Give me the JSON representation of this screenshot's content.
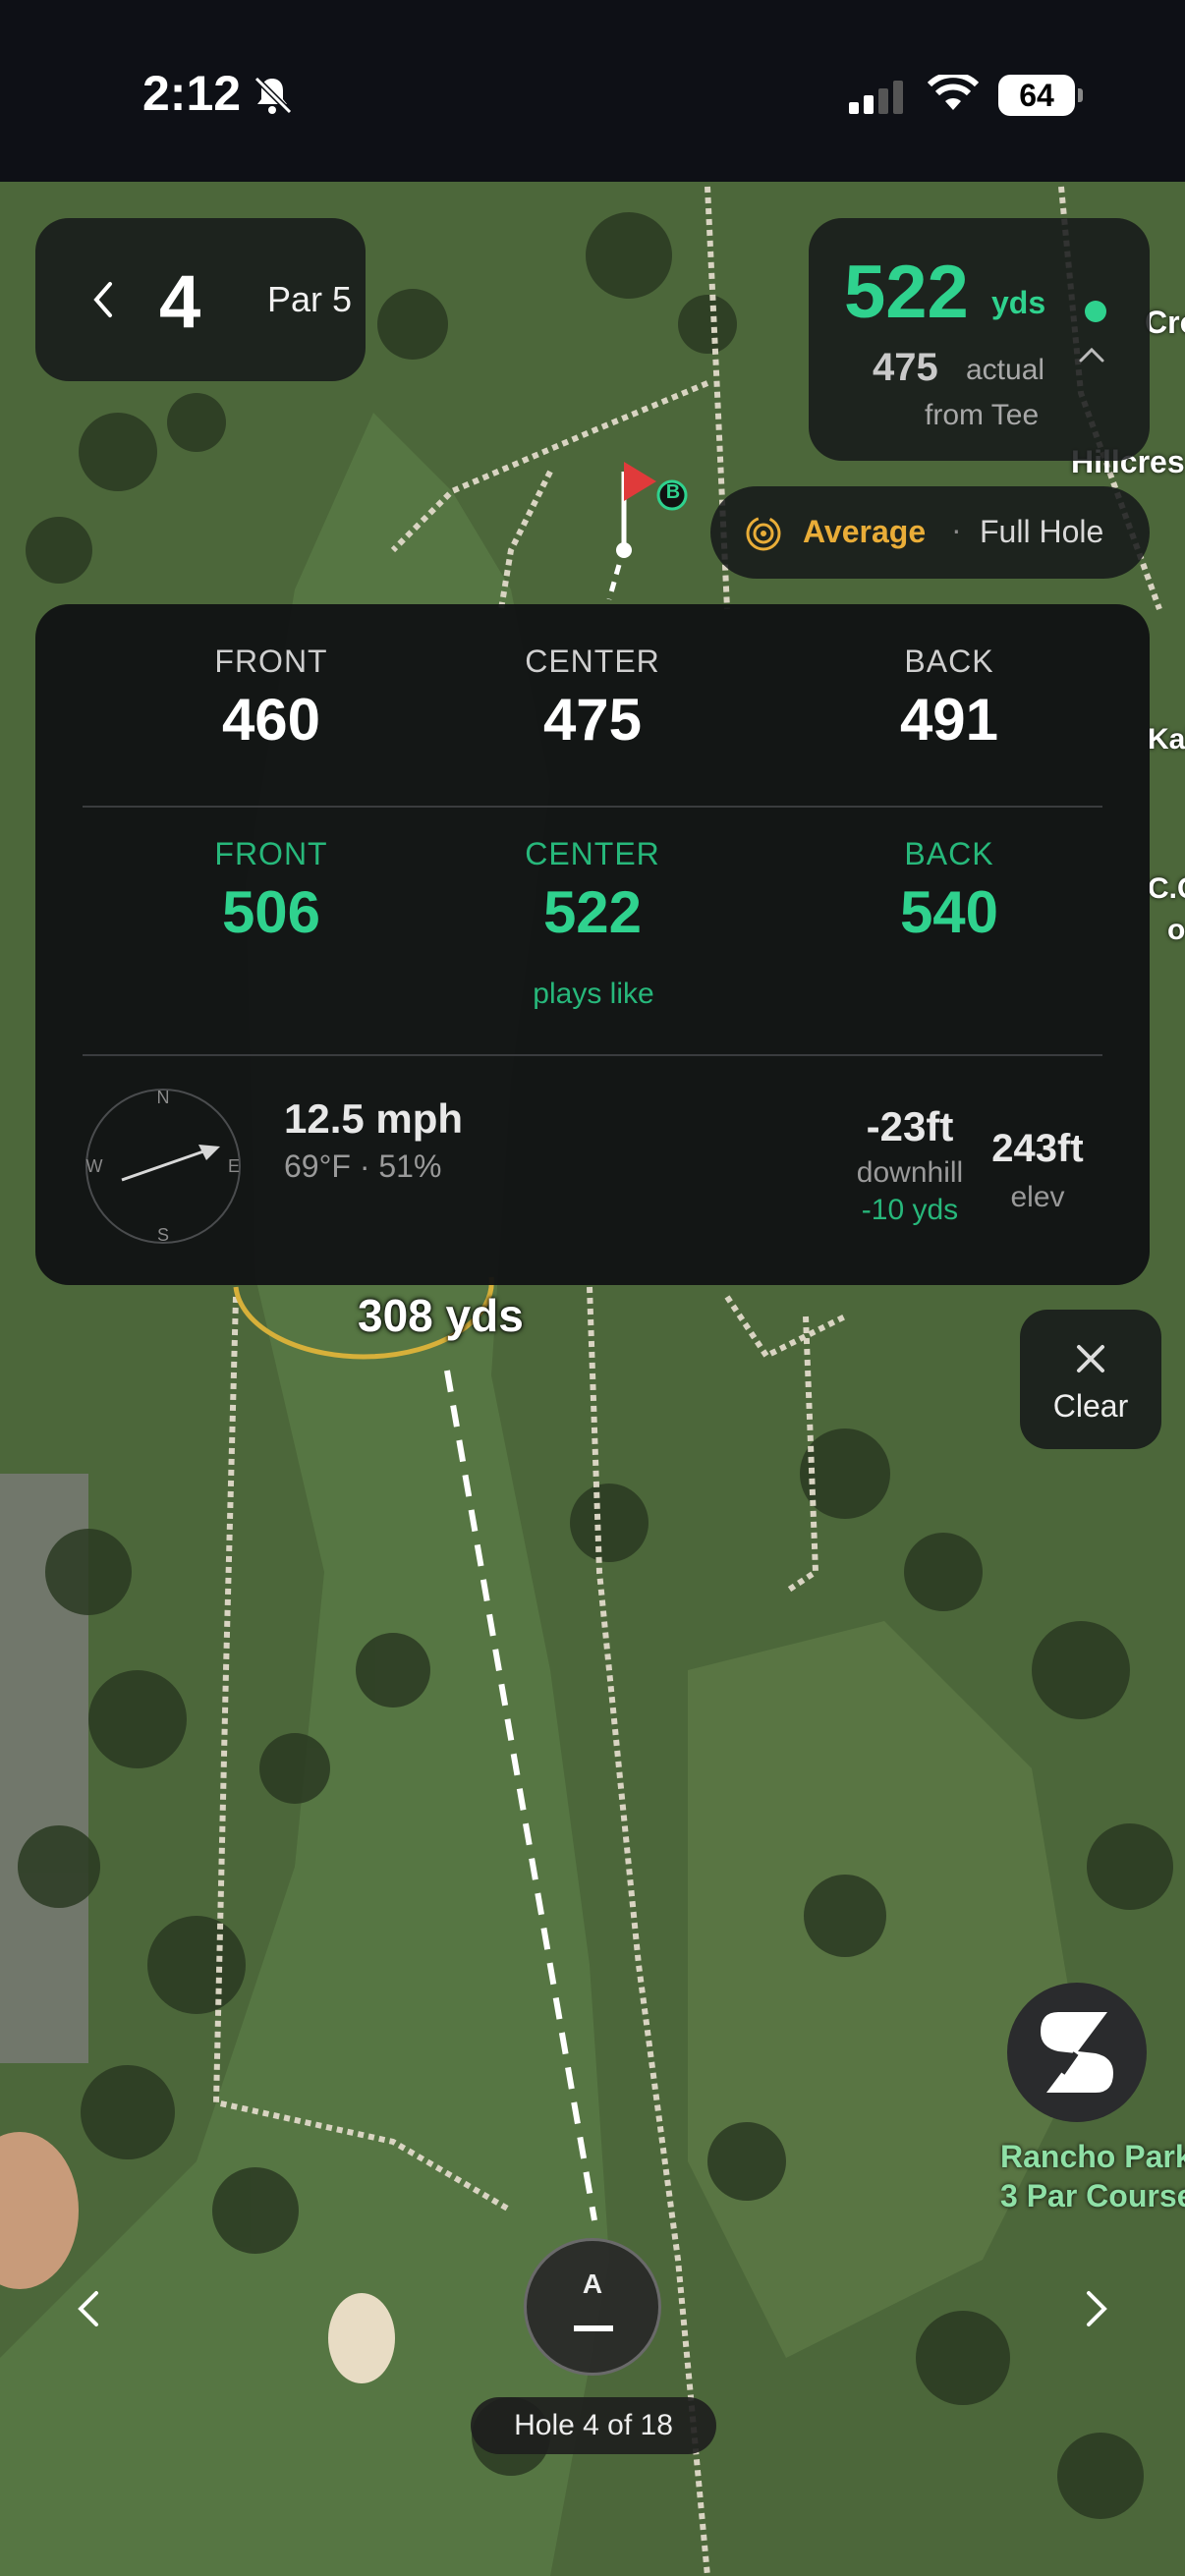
{
  "status_bar": {
    "time": "2:12",
    "battery": "64"
  },
  "hole": {
    "number": "4",
    "par": "Par 5"
  },
  "yardage": {
    "plays_like": "522",
    "plays_like_unit": "yds",
    "actual": "475",
    "actual_label": "actual",
    "from": "from Tee"
  },
  "mode": {
    "strategy": "Average",
    "separator": "·",
    "view": "Full Hole"
  },
  "stats": {
    "actual": [
      {
        "label": "FRONT",
        "value": "460"
      },
      {
        "label": "CENTER",
        "value": "475"
      },
      {
        "label": "BACK",
        "value": "491"
      }
    ],
    "plays_like": [
      {
        "label": "FRONT",
        "value": "506"
      },
      {
        "label": "CENTER",
        "value": "522"
      },
      {
        "label": "BACK",
        "value": "540"
      }
    ],
    "plays_like_caption": "plays like",
    "wind_speed": "12.5 mph",
    "conditions": "69°F · 51%",
    "elevation_change": "-23ft",
    "elevation_change_label": "downhill",
    "elevation_adjust": "-10 yds",
    "elevation": "243ft",
    "elevation_label": "elev",
    "compass": {
      "n": "N",
      "s": "S",
      "e": "E",
      "w": "W"
    }
  },
  "map": {
    "shot_distance": "308 yds",
    "labels": [
      "Cro",
      "Hillcres",
      "Kal",
      "C.C",
      "o"
    ],
    "green_marker": "B",
    "course_label_1": "Rancho Park",
    "course_label_2": "3 Par Course"
  },
  "buttons": {
    "clear": "Clear",
    "shot_marker": "A"
  },
  "footer": {
    "hole_indicator": "Hole 4 of 18"
  },
  "colors": {
    "accent_green": "#2fd28e",
    "accent_gold": "#e9ad38",
    "panel": "#16181a"
  },
  "icons": [
    "back-chevron-icon",
    "chevron-up-icon",
    "target-icon",
    "close-icon",
    "brand-logo-icon",
    "flag-icon",
    "chevron-left-icon",
    "chevron-right-icon"
  ]
}
